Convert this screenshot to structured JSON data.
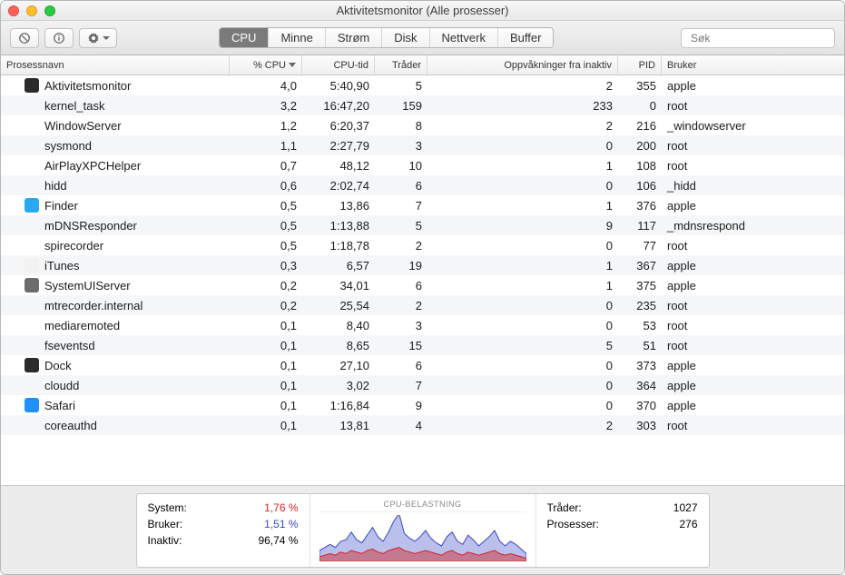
{
  "window_title": "Aktivitetsmonitor (Alle prosesser)",
  "toolbar": {
    "tabs": [
      {
        "label": "CPU",
        "active": true
      },
      {
        "label": "Minne",
        "active": false
      },
      {
        "label": "Strøm",
        "active": false
      },
      {
        "label": "Disk",
        "active": false
      },
      {
        "label": "Nettverk",
        "active": false
      },
      {
        "label": "Buffer",
        "active": false
      }
    ],
    "search_placeholder": "Søk"
  },
  "columns": {
    "name": "Prosessnavn",
    "cpu": "% CPU",
    "time": "CPU-tid",
    "threads": "Tråder",
    "awake": "Oppvåkninger fra inaktiv",
    "pid": "PID",
    "user": "Bruker"
  },
  "processes": [
    {
      "icon": "activity",
      "name": "Aktivitetsmonitor",
      "cpu": "4,0",
      "time": "5:40,90",
      "thr": "5",
      "awk": "2",
      "pid": "355",
      "user": "apple"
    },
    {
      "icon": "",
      "name": "kernel_task",
      "cpu": "3,2",
      "time": "16:47,20",
      "thr": "159",
      "awk": "233",
      "pid": "0",
      "user": "root"
    },
    {
      "icon": "",
      "name": "WindowServer",
      "cpu": "1,2",
      "time": "6:20,37",
      "thr": "8",
      "awk": "2",
      "pid": "216",
      "user": "_windowserver"
    },
    {
      "icon": "",
      "name": "sysmond",
      "cpu": "1,1",
      "time": "2:27,79",
      "thr": "3",
      "awk": "0",
      "pid": "200",
      "user": "root"
    },
    {
      "icon": "",
      "name": "AirPlayXPCHelper",
      "cpu": "0,7",
      "time": "48,12",
      "thr": "10",
      "awk": "1",
      "pid": "108",
      "user": "root"
    },
    {
      "icon": "",
      "name": "hidd",
      "cpu": "0,6",
      "time": "2:02,74",
      "thr": "6",
      "awk": "0",
      "pid": "106",
      "user": "_hidd"
    },
    {
      "icon": "finder",
      "name": "Finder",
      "cpu": "0,5",
      "time": "13,86",
      "thr": "7",
      "awk": "1",
      "pid": "376",
      "user": "apple"
    },
    {
      "icon": "",
      "name": "mDNSResponder",
      "cpu": "0,5",
      "time": "1:13,88",
      "thr": "5",
      "awk": "9",
      "pid": "117",
      "user": "_mdnsrespond"
    },
    {
      "icon": "",
      "name": "spirecorder",
      "cpu": "0,5",
      "time": "1:18,78",
      "thr": "2",
      "awk": "0",
      "pid": "77",
      "user": "root"
    },
    {
      "icon": "itunes",
      "name": "iTunes",
      "cpu": "0,3",
      "time": "6,57",
      "thr": "19",
      "awk": "1",
      "pid": "367",
      "user": "apple"
    },
    {
      "icon": "uiserver",
      "name": "SystemUIServer",
      "cpu": "0,2",
      "time": "34,01",
      "thr": "6",
      "awk": "1",
      "pid": "375",
      "user": "apple"
    },
    {
      "icon": "",
      "name": "mtrecorder.internal",
      "cpu": "0,2",
      "time": "25,54",
      "thr": "2",
      "awk": "0",
      "pid": "235",
      "user": "root"
    },
    {
      "icon": "",
      "name": "mediaremoted",
      "cpu": "0,1",
      "time": "8,40",
      "thr": "3",
      "awk": "0",
      "pid": "53",
      "user": "root"
    },
    {
      "icon": "",
      "name": "fseventsd",
      "cpu": "0,1",
      "time": "8,65",
      "thr": "15",
      "awk": "5",
      "pid": "51",
      "user": "root"
    },
    {
      "icon": "dock",
      "name": "Dock",
      "cpu": "0,1",
      "time": "27,10",
      "thr": "6",
      "awk": "0",
      "pid": "373",
      "user": "apple"
    },
    {
      "icon": "",
      "name": "cloudd",
      "cpu": "0,1",
      "time": "3,02",
      "thr": "7",
      "awk": "0",
      "pid": "364",
      "user": "apple"
    },
    {
      "icon": "safari",
      "name": "Safari",
      "cpu": "0,1",
      "time": "1:16,84",
      "thr": "9",
      "awk": "0",
      "pid": "370",
      "user": "apple"
    },
    {
      "icon": "",
      "name": "coreauthd",
      "cpu": "0,1",
      "time": "13,81",
      "thr": "4",
      "awk": "2",
      "pid": "303",
      "user": "root"
    }
  ],
  "footer": {
    "left": {
      "system_label": "System:",
      "system_value": "1,76 %",
      "user_label": "Bruker:",
      "user_value": "1,51 %",
      "idle_label": "Inaktiv:",
      "idle_value": "96,74 %"
    },
    "chart_title": "CPU-BELASTNING",
    "right": {
      "threads_label": "Tråder:",
      "threads_value": "1027",
      "proc_label": "Prosesser:",
      "proc_value": "276"
    }
  },
  "chart_data": {
    "type": "area",
    "title": "CPU-BELASTNING",
    "ylim": [
      0,
      30
    ],
    "series": [
      {
        "name": "System",
        "color": "#d32424",
        "values": [
          3,
          4,
          5,
          4,
          6,
          5,
          7,
          6,
          5,
          7,
          8,
          6,
          5,
          7,
          8,
          9,
          7,
          6,
          5,
          6,
          7,
          6,
          5,
          4,
          6,
          7,
          5,
          4,
          6,
          5,
          4,
          5,
          6,
          7,
          5,
          4,
          5,
          4,
          3,
          2
        ]
      },
      {
        "name": "Bruker",
        "color": "#3848c8",
        "values": [
          4,
          5,
          6,
          5,
          7,
          9,
          12,
          8,
          7,
          10,
          14,
          10,
          8,
          12,
          18,
          22,
          11,
          9,
          8,
          10,
          13,
          9,
          7,
          6,
          10,
          12,
          8,
          7,
          11,
          9,
          6,
          8,
          10,
          13,
          8,
          6,
          8,
          7,
          5,
          3
        ]
      }
    ]
  },
  "icon_colors": {
    "activity": "#2b2b2b",
    "finder": "#2aa9f3",
    "itunes": "#f2f2f2",
    "uiserver": "#6c6c6c",
    "dock": "#2b2b2b",
    "safari": "#1e90ff"
  }
}
